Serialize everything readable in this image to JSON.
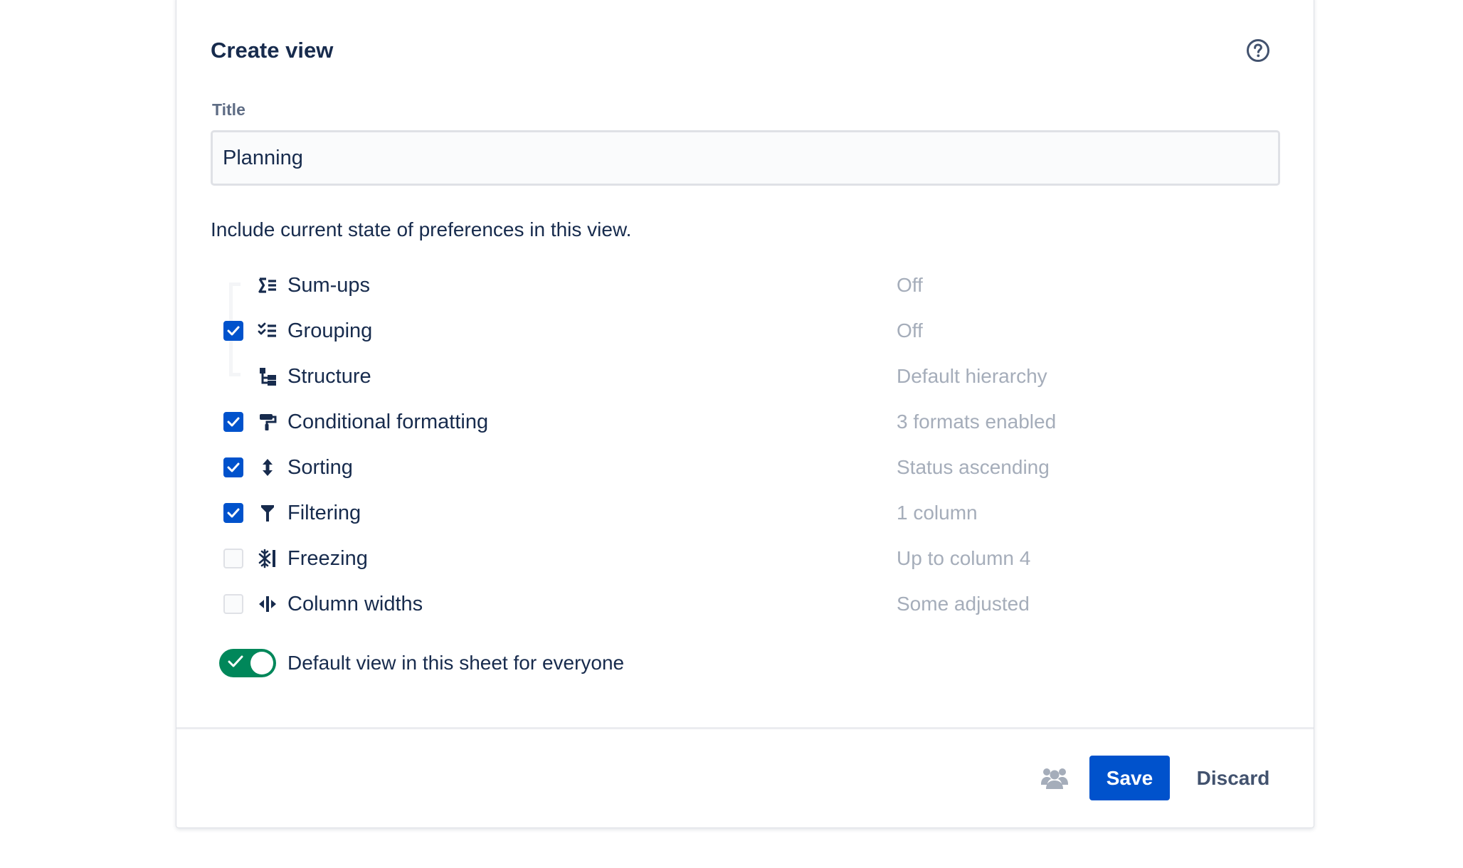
{
  "dialog": {
    "title": "Create view",
    "help_icon": "question-circle-icon"
  },
  "title_field": {
    "label": "Title",
    "value": "Planning",
    "placeholder": ""
  },
  "description": "Include current state of preferences in this view.",
  "options": [
    {
      "label": "Sum-ups",
      "value": "Off",
      "icon": "sigma-list-icon",
      "checked": null
    },
    {
      "label": "Grouping",
      "value": "Off",
      "icon": "grouping-icon",
      "checked": true
    },
    {
      "label": "Structure",
      "value": "Default hierarchy",
      "icon": "structure-icon",
      "checked": null
    },
    {
      "label": "Conditional formatting",
      "value": "3 formats enabled",
      "icon": "paint-roller-icon",
      "checked": true
    },
    {
      "label": "Sorting",
      "value": "Status ascending",
      "icon": "sort-arrows-icon",
      "checked": true
    },
    {
      "label": "Filtering",
      "value": "1 column",
      "icon": "filter-icon",
      "checked": true
    },
    {
      "label": "Freezing",
      "value": "Up to column 4",
      "icon": "snowflake-icon",
      "checked": false
    },
    {
      "label": "Column widths",
      "value": "Some adjusted",
      "icon": "column-width-icon",
      "checked": false
    }
  ],
  "default_toggle": {
    "label": "Default view in this sheet for everyone",
    "on": true
  },
  "footer": {
    "people_icon": "people-group-icon",
    "save_label": "Save",
    "discard_label": "Discard"
  },
  "colors": {
    "primary": "#0052CC",
    "toggle_on": "#00875A",
    "text": "#172B4D",
    "muted_value": "#A5ADBA"
  }
}
